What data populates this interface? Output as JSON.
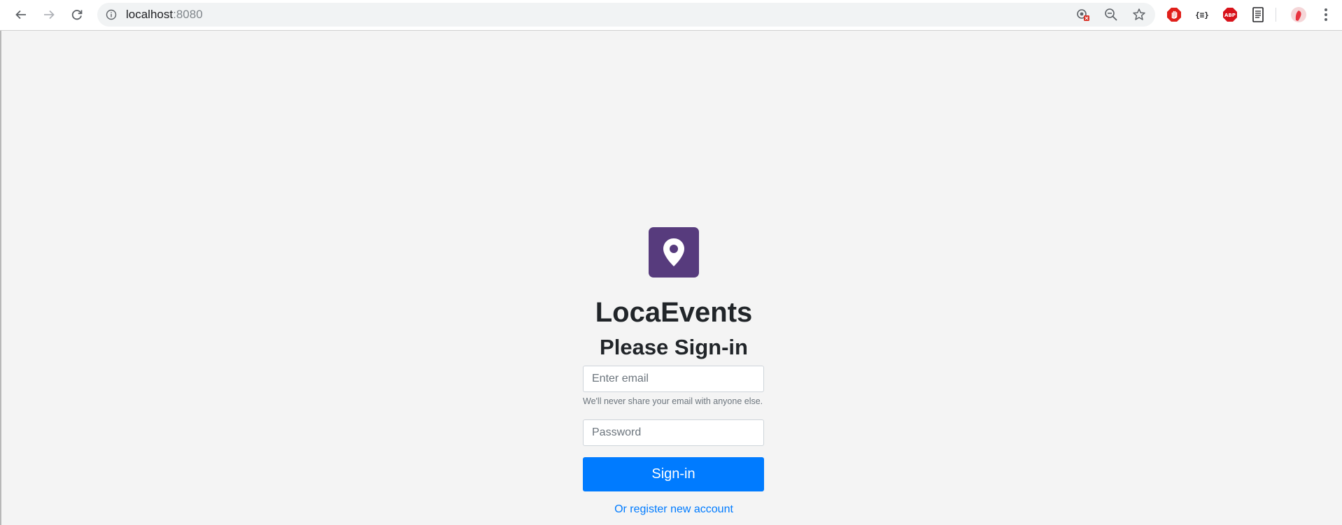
{
  "browser": {
    "url_host": "localhost",
    "url_port": ":8080",
    "icons": {
      "back": "arrow-left-icon",
      "forward": "arrow-right-icon",
      "reload": "reload-icon",
      "site_info": "info-icon",
      "camera_blocked": "camera-blocked-icon",
      "zoom": "zoom-out-icon",
      "bookmark": "star-icon",
      "menu": "more-vert-icon"
    },
    "extensions": [
      {
        "name": "stop-sign-extension",
        "color": "#e0201b"
      },
      {
        "name": "json-formatter-extension",
        "label": "{≡}"
      },
      {
        "name": "adblock-plus-extension",
        "label": "ABP",
        "color": "#d8131b"
      },
      {
        "name": "document-extension"
      },
      {
        "name": "profile-avatar",
        "color": "#e8333f"
      }
    ]
  },
  "login": {
    "logo_icon": "map-pin-icon",
    "logo_color": "#573b7d",
    "app_name": "LocaEvents",
    "heading": "Please Sign-in",
    "email_placeholder": "Enter email",
    "email_help": "We'll never share your email with anyone else.",
    "password_placeholder": "Password",
    "signin_label": "Sign-in",
    "register_link": "Or register new account",
    "accent_color": "#007bff"
  }
}
